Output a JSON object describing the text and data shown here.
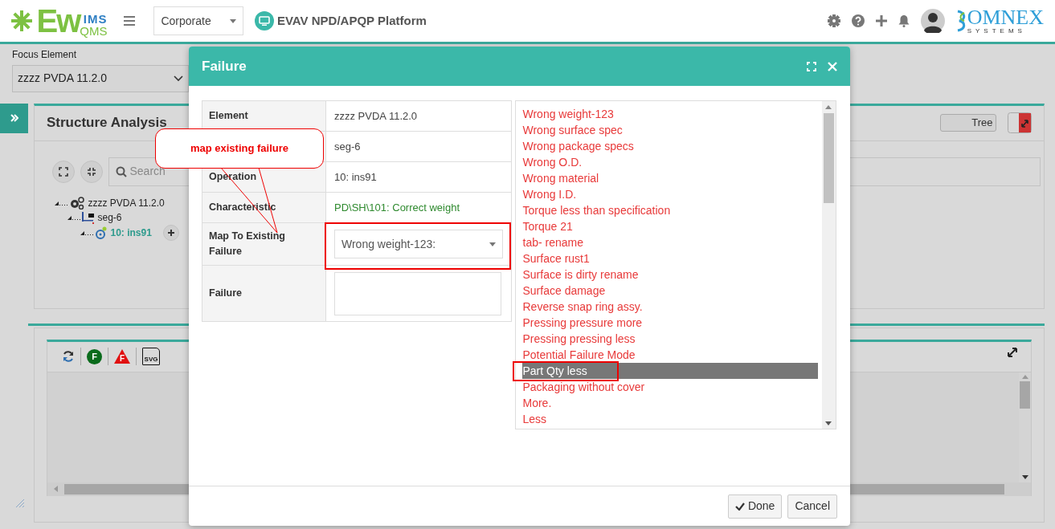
{
  "header": {
    "logo": {
      "main": "Ew",
      "top": "IMS",
      "bottom": "QMS"
    },
    "company_select": "Corporate",
    "platform_title": "EVAV NPD/APQP Platform",
    "brand": {
      "name": "OMNEX",
      "tagline": "SYSTEMS"
    }
  },
  "focus_element": {
    "label": "Focus Element",
    "value": "zzzz PVDA 11.2.0"
  },
  "structure_panel": {
    "title": "Structure Analysis",
    "view_toggle": "Tree",
    "search_placeholder": "Search",
    "tree": [
      {
        "label": "zzzz PVDA 11.2.0",
        "kind": "element",
        "children": [
          {
            "label": "seg-6",
            "kind": "segment",
            "children": [
              {
                "label": "10: ins91",
                "kind": "operation"
              }
            ]
          }
        ]
      }
    ]
  },
  "graph_panel": {
    "toolbar": [
      {
        "kind": "refresh"
      },
      {
        "kind": "circle",
        "letter": "F"
      },
      {
        "kind": "triangle",
        "letter": "F"
      },
      {
        "kind": "file",
        "letter": "SVG"
      }
    ]
  },
  "modal": {
    "title": "Failure",
    "fields": [
      {
        "label": "Element",
        "value": "zzzz PVDA 11.2.0",
        "kind": "text"
      },
      {
        "value": "seg-6",
        "kind": "text"
      },
      {
        "label": "Operation",
        "value": "10: ins91",
        "kind": "text"
      },
      {
        "label": "Characteristic",
        "value": "PD\\SH\\101: Correct weight",
        "kind": "link"
      },
      {
        "label": "Map To Existing Failure",
        "value": "Wrong weight-123:",
        "kind": "select"
      },
      {
        "label": "Failure",
        "kind": "textarea"
      }
    ],
    "failure_list": [
      {
        "label": "Wrong weight-123",
        "selected": false
      },
      {
        "label": "Wrong surface spec",
        "selected": false
      },
      {
        "label": "Wrong package specs",
        "selected": false
      },
      {
        "label": "Wrong O.D.",
        "selected": false
      },
      {
        "label": "Wrong material",
        "selected": false
      },
      {
        "label": "Wrong I.D.",
        "selected": false
      },
      {
        "label": "Torque less than specification",
        "selected": false
      },
      {
        "label": "Torque 21",
        "selected": false
      },
      {
        "label": "tab- rename",
        "selected": false
      },
      {
        "label": "Surface rust1",
        "selected": false
      },
      {
        "label": "Surface is dirty rename",
        "selected": false
      },
      {
        "label": "Surface damage",
        "selected": false
      },
      {
        "label": "Reverse snap ring assy.",
        "selected": false
      },
      {
        "label": "Pressing pressure more",
        "selected": false
      },
      {
        "label": "Pressing pressing less",
        "selected": false
      },
      {
        "label": "Potential Failure Mode",
        "selected": false
      },
      {
        "label": "Part Qty less",
        "selected": true
      },
      {
        "label": "Packaging without cover",
        "selected": false
      },
      {
        "label": "More.",
        "selected": false
      },
      {
        "label": "Less",
        "selected": false
      }
    ],
    "buttons": [
      {
        "label": "Done",
        "kind": "confirm"
      },
      {
        "label": "Cancel",
        "kind": "cancel"
      }
    ]
  },
  "annotation": {
    "callout": "map existing failure"
  }
}
